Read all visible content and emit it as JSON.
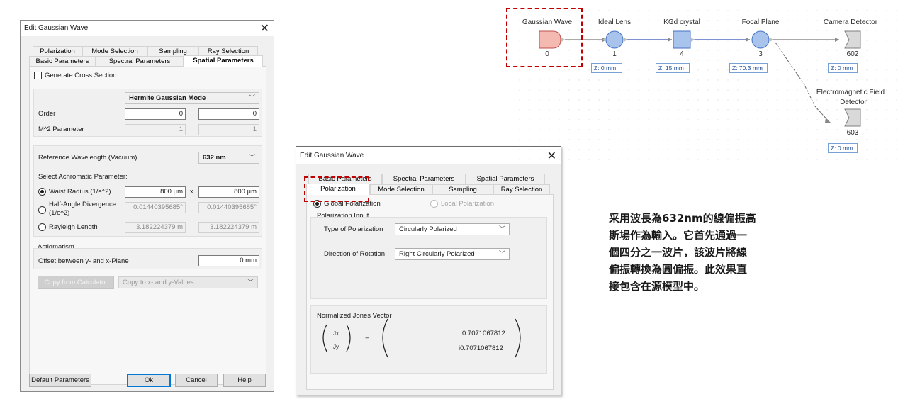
{
  "dialog1": {
    "title": "Edit Gaussian Wave",
    "tabs_row1": [
      "Polarization",
      "Mode Selection",
      "Sampling",
      "Ray Selection"
    ],
    "tabs_row2": [
      "Basic Parameters",
      "Spectral Parameters",
      "Spatial Parameters"
    ],
    "active_tab": "Spatial Parameters",
    "generate_cross_section": "Generate Cross Section",
    "mode_combo": "Hermite Gaussian Mode",
    "order_label": "Order",
    "order_x": "0",
    "order_y": "0",
    "m2_label": "M^2 Parameter",
    "m2_x": "1",
    "m2_y": "1",
    "ref_wavelength_label": "Reference Wavelength (Vacuum)",
    "ref_wavelength_value": "632 nm",
    "achromatic_label": "Select Achromatic Parameter:",
    "waist_label": "Waist Radius (1/e^2)",
    "waist_x": "800 µm",
    "waist_y": "800 µm",
    "times": "x",
    "divergence_label_1": "Half-Angle Divergence",
    "divergence_label_2": "(1/e^2)",
    "divergence_x": "0.01440395685°",
    "divergence_y": "0.01440395685°",
    "rayleigh_label": "Rayleigh Length",
    "rayleigh_x": "3.182224379",
    "rayleigh_y": "3.182224379",
    "rayleigh_unit": "m",
    "astigmatism_label": "Astigmatism",
    "offset_label": "Offset between y- and x-Plane",
    "offset_value": "0 mm",
    "copy_from_calc": "Copy from Calculator",
    "copy_to_combo": "Copy to x- and y-Values",
    "default_params": "Default Parameters",
    "ok": "Ok",
    "cancel": "Cancel",
    "help": "Help"
  },
  "dialog2": {
    "title": "Edit Gaussian Wave",
    "tabs_row1": [
      "Basic Parameters",
      "Spectral Parameters",
      "Spatial Parameters"
    ],
    "tabs_row2": [
      "Polarization",
      "Mode Selection",
      "Sampling",
      "Ray Selection"
    ],
    "active_tab": "Polarization",
    "global_pol": "Global Polarization",
    "local_pol": "Local Polarization",
    "pol_input": "Polarization Input",
    "type_label": "Type of Polarization",
    "type_value": "Circularly Polarized",
    "direction_label": "Direction of Rotation",
    "direction_value": "Right Circularly Polarized",
    "jones_label": "Normalized Jones Vector",
    "jx": "Jx",
    "jy": "Jy",
    "equals": "=",
    "jones_x": "0.7071067812",
    "jones_y": "i0.7071067812"
  },
  "diagram": {
    "components": [
      {
        "name": "Gaussian Wave",
        "id": "0"
      },
      {
        "name": "Ideal Lens",
        "id": "1",
        "z": "Z: 0 mm"
      },
      {
        "name": "KGd crystal",
        "id": "4",
        "z": "Z: 15 mm"
      },
      {
        "name": "Focal Plane",
        "id": "3",
        "z": "Z: 70.3 mm"
      },
      {
        "name": "Camera Detector",
        "id": "602",
        "z": "Z: 0 mm"
      }
    ],
    "em_detector": {
      "name_1": "Electromagnetic Field",
      "name_2": "Detector",
      "id": "603",
      "z": "Z: 0 mm"
    }
  },
  "note": {
    "lines": [
      "采用波長為632nm的線偏振高",
      "斯場作為輸入。它首先通過一",
      "個四分之一波片，該波片將線",
      "偏振轉換為圓偏振。此效果直",
      "接包含在源模型中。"
    ]
  },
  "colors": {
    "highlight": "#c00000",
    "source_fill": "#f4b9b0",
    "lens_fill": "#a9c4ec",
    "detector_fill": "#d9d9d9",
    "link_blue": "#3050b8",
    "zbox_text": "#1f4e9a"
  }
}
